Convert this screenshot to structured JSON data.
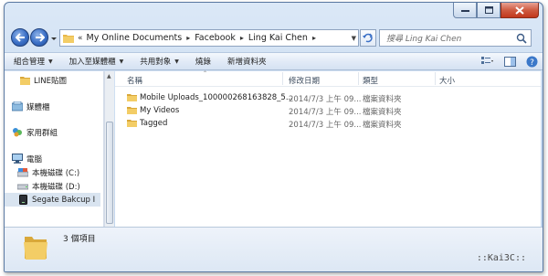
{
  "window": {
    "caption_buttons": [
      "minimize-icon",
      "maximize-icon",
      "close-icon"
    ]
  },
  "address_bar": {
    "prefix": "«",
    "crumbs": [
      "My Online Documents",
      "Facebook",
      "Ling Kai Chen"
    ],
    "search_placeholder": "搜尋 Ling Kai Chen"
  },
  "toolbar": {
    "items": [
      {
        "label": "組合管理",
        "has_arrow": true
      },
      {
        "label": "加入至媒體櫃",
        "has_arrow": true
      },
      {
        "label": "共用對象",
        "has_arrow": true
      },
      {
        "label": "燒錄",
        "has_arrow": false
      },
      {
        "label": "新增資料夾",
        "has_arrow": false
      }
    ]
  },
  "sidebar": {
    "items": [
      {
        "label": "LINE貼圖",
        "icon": "folder-icon"
      },
      {
        "label": "媒體櫃",
        "icon": "library-icon"
      },
      {
        "label": "家用群組",
        "icon": "homegroup-icon"
      },
      {
        "label": "電腦",
        "icon": "computer-icon"
      },
      {
        "label": "本機磁碟 (C:)",
        "icon": "drive-c-icon"
      },
      {
        "label": "本機磁碟 (D:)",
        "icon": "drive-d-icon"
      },
      {
        "label": "Segate Bakcup I",
        "icon": "external-drive-icon"
      }
    ]
  },
  "file_list": {
    "columns": [
      "名稱",
      "修改日期",
      "類型",
      "大小"
    ],
    "rows": [
      {
        "name": "Mobile Uploads_100000268163828_5...",
        "date": "2014/7/3 上午 09...",
        "type": "檔案資料夾"
      },
      {
        "name": "My Videos",
        "date": "2014/7/3 上午 09...",
        "type": "檔案資料夾"
      },
      {
        "name": "Tagged",
        "date": "2014/7/3 上午 09...",
        "type": "檔案資料夾"
      }
    ]
  },
  "details": {
    "count_label": "3 個項目"
  },
  "watermark": "::Kai3C::",
  "colors": {
    "folder": "#e8b84a",
    "accent_blue": "#3a6fc6",
    "close_red": "#c1381d"
  }
}
